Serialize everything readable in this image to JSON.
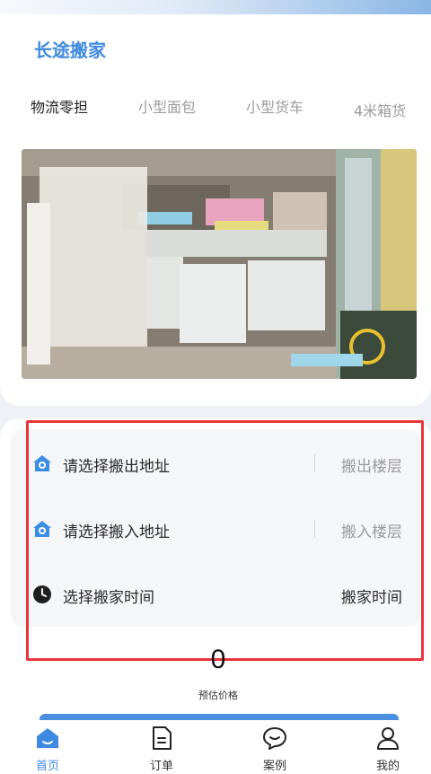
{
  "header": {
    "title": "长途搬家"
  },
  "vehicle_tabs": [
    {
      "label": "物流零担",
      "active": true
    },
    {
      "label": "小型面包",
      "active": false
    },
    {
      "label": "小型货车",
      "active": false
    },
    {
      "label": "4米箱货",
      "active": false
    }
  ],
  "form": {
    "move_out": {
      "label": "请选择搬出地址",
      "floor": "搬出楼层",
      "icon": "home-pin-icon"
    },
    "move_in": {
      "label": "请选择搬入地址",
      "floor": "搬入楼层",
      "icon": "home-pin-icon"
    },
    "time": {
      "label": "选择搬家时间",
      "value": "搬家时间",
      "icon": "clock-icon"
    }
  },
  "price": {
    "value": "0",
    "label": "预估价格"
  },
  "tabbar": [
    {
      "label": "首页",
      "icon": "home-icon",
      "active": true
    },
    {
      "label": "订单",
      "icon": "document-icon",
      "active": false
    },
    {
      "label": "案例",
      "icon": "chat-bubble-icon",
      "active": false
    },
    {
      "label": "我的",
      "icon": "user-icon",
      "active": false
    }
  ],
  "colors": {
    "accent": "#3f8ae0",
    "highlight": "#e8353b"
  }
}
